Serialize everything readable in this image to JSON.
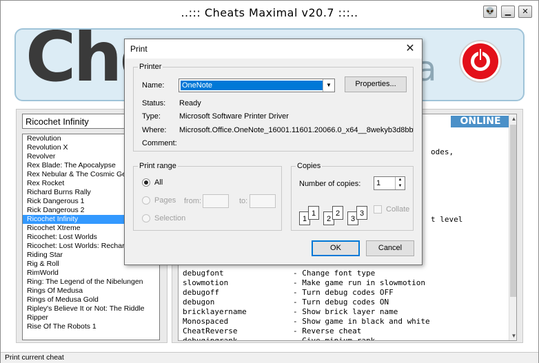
{
  "app": {
    "title": "..::: Cheats Maximal v20.7 :::..",
    "logo_text": "Che",
    "logo_tail": "a"
  },
  "window_controls": {
    "alien": "👽",
    "minimize": "▁",
    "close": "✕"
  },
  "game_select": {
    "value": "Ricochet Infinity"
  },
  "games": [
    "Revolution",
    "Revolution X",
    "Revolver",
    "Rex Blade: The Apocalypse",
    "Rex Nebular & The Cosmic Gender Bender",
    "Rex Rocket",
    "Richard Burns Rally",
    "Rick Dangerous 1",
    "Rick Dangerous 2",
    "Ricochet Infinity",
    "Ricochet Xtreme",
    "Ricochet: Lost Worlds",
    "Ricochet: Lost Worlds: Recharged",
    "Riding Star",
    "Rig & Roll",
    "RimWorld",
    "Ring: The Legend of the Nibelungen",
    "Rings Of Medusa",
    "Rings of Medusa Gold",
    "Ripley's Believe It or Not: The Riddle",
    "Ripper",
    "Rise Of The Robots 1"
  ],
  "selected_game_index": 9,
  "online_badge": "ONLINE",
  "cheat_fragments": {
    "line_codes": "odes,",
    "line_level": "t level"
  },
  "cheat_lines": [
    {
      "cmd": "debugfont",
      "desc": "- Change font type"
    },
    {
      "cmd": "slowmotion",
      "desc": "- Make game run in slowmotion"
    },
    {
      "cmd": "debugoff",
      "desc": "- Turn debug codes OFF"
    },
    {
      "cmd": "debugon",
      "desc": "- Turn debug codes ON"
    },
    {
      "cmd": "bricklayername",
      "desc": "- Show brick layer name"
    },
    {
      "cmd": "Monospaced",
      "desc": "- Show game in black and white"
    },
    {
      "cmd": "CheatReverse",
      "desc": "- Reverse cheat"
    },
    {
      "cmd": "debugjpgrank",
      "desc": "- Give minium rank"
    }
  ],
  "status_bar": "Print current cheat",
  "print_dialog": {
    "title": "Print",
    "close": "✕",
    "printer": {
      "group_label": "Printer",
      "name_label": "Name:",
      "name_value": "OneNote",
      "properties_button": "Properties...",
      "status_label": "Status:",
      "status_value": "Ready",
      "type_label": "Type:",
      "type_value": "Microsoft Software Printer Driver",
      "where_label": "Where:",
      "where_value": "Microsoft.Office.OneNote_16001.11601.20066.0_x64__8wekyb3d8bbw",
      "comment_label": "Comment:"
    },
    "print_range": {
      "group_label": "Print range",
      "all": "All",
      "pages": "Pages",
      "from": "from:",
      "to": "to:",
      "selection": "Selection"
    },
    "copies": {
      "group_label": "Copies",
      "number_label": "Number of copies:",
      "number_value": "1",
      "collate": "Collate",
      "page_labels": [
        "1",
        "1",
        "2",
        "2",
        "3",
        "3"
      ]
    },
    "ok_button": "OK",
    "cancel_button": "Cancel"
  }
}
